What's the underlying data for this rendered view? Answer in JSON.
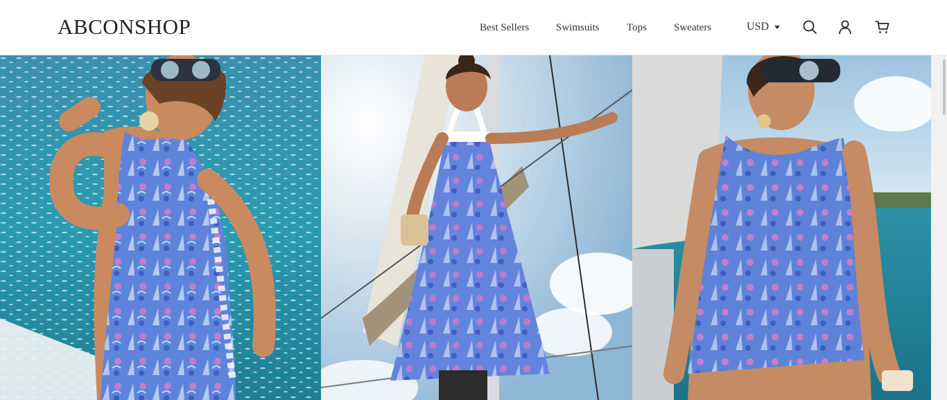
{
  "header": {
    "logo": "ABCONSHOP",
    "nav": [
      {
        "label": "Best Sellers"
      },
      {
        "label": "Swimsuits"
      },
      {
        "label": "Tops"
      },
      {
        "label": "Sweaters"
      }
    ],
    "currency": "USD",
    "icons": [
      "search-icon",
      "account-icon",
      "cart-icon"
    ]
  },
  "hero": {
    "images": [
      {
        "subject": "woman-in-blue-print-sheath-dress-by-sea"
      },
      {
        "subject": "woman-in-blue-print-maxi-dress-on-sailboat"
      },
      {
        "subject": "woman-in-blue-print-shift-dress-seated-on-boat"
      }
    ]
  },
  "colors": {
    "text": "#222222",
    "sea": "#2b8fa8",
    "sky": "#b9d6ea",
    "dress_blue": "#5b7fd8",
    "dress_pink": "#e07ac4",
    "sail": "#a89a7e"
  }
}
